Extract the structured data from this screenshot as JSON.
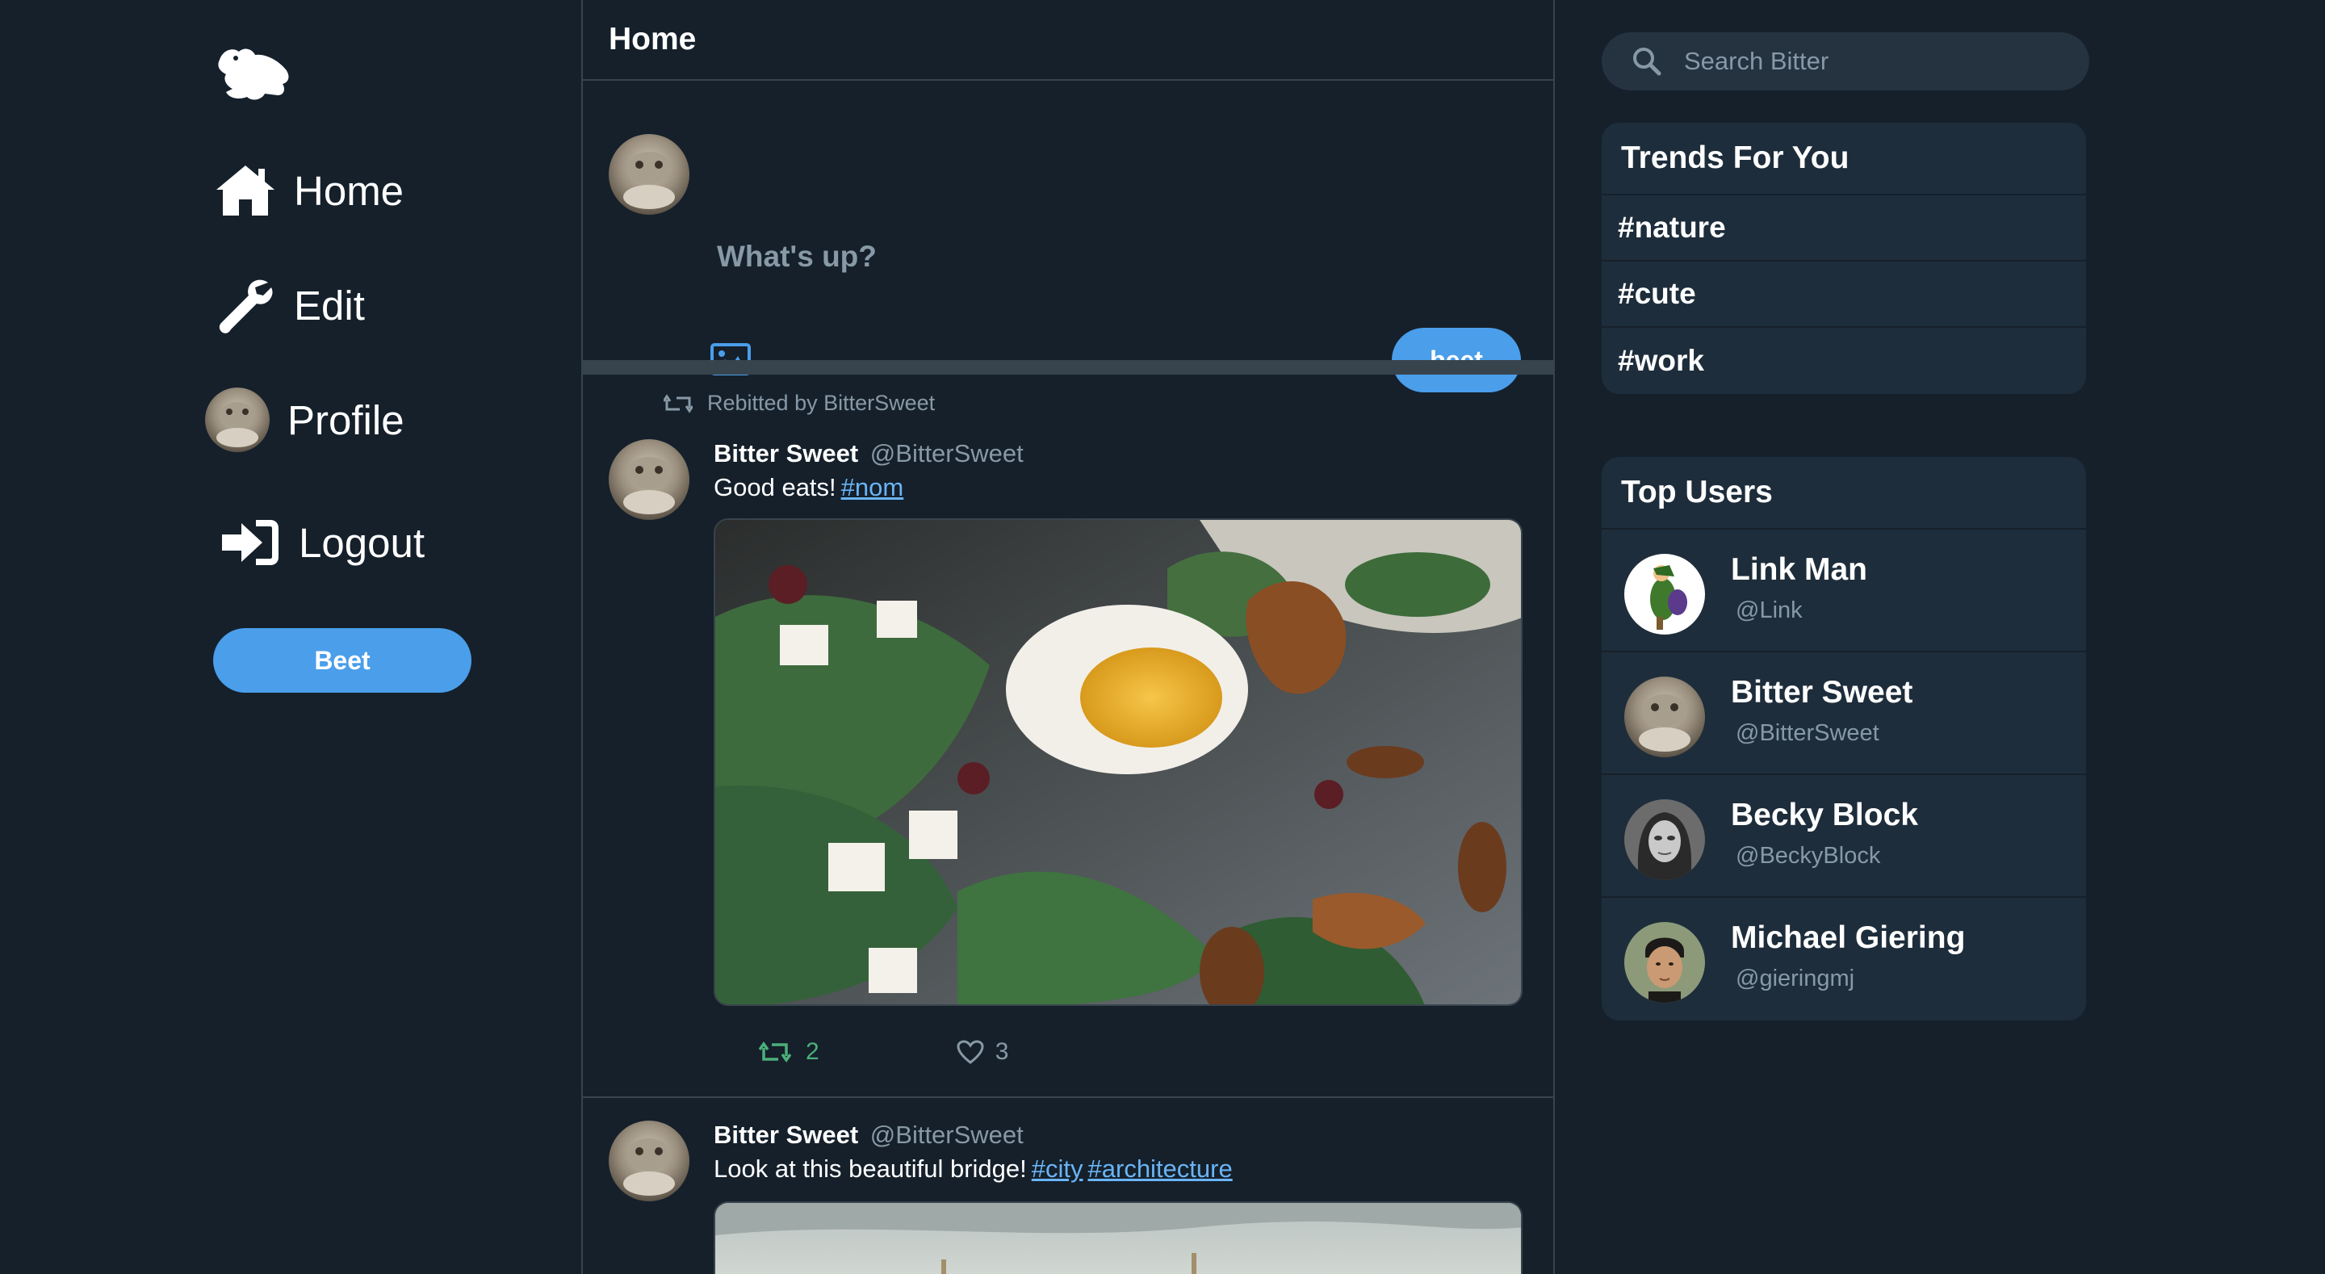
{
  "nav": {
    "items": [
      {
        "label": "Home",
        "icon": "home-icon"
      },
      {
        "label": "Edit",
        "icon": "wrench-icon"
      },
      {
        "label": "Profile",
        "icon": "avatar"
      },
      {
        "label": "Logout",
        "icon": "logout-icon"
      }
    ],
    "beet_label": "Beet",
    "logo": "frog-logo-icon"
  },
  "feed": {
    "title": "Home",
    "composer": {
      "placeholder": "What's up?",
      "submit_label": "beet"
    },
    "posts": [
      {
        "rebit_text": "Rebitted by BitterSweet",
        "name": "Bitter Sweet",
        "handle": "@BitterSweet",
        "text": "Good eats!",
        "tags": [
          "#nom"
        ],
        "rebeets": "2",
        "likes": "3"
      },
      {
        "name": "Bitter Sweet",
        "handle": "@BitterSweet",
        "text": "Look at this beautiful bridge!",
        "tags": [
          "#city",
          "#architecture"
        ]
      }
    ]
  },
  "search": {
    "placeholder": "Search Bitter"
  },
  "trends": {
    "title": "Trends For You",
    "items": [
      "#nature",
      "#cute",
      "#work"
    ]
  },
  "top_users": {
    "title": "Top Users",
    "users": [
      {
        "name": "Link Man",
        "handle": "@Link"
      },
      {
        "name": "Bitter Sweet",
        "handle": "@BitterSweet"
      },
      {
        "name": "Becky Block",
        "handle": "@BeckyBlock"
      },
      {
        "name": "Michael Giering",
        "handle": "@gieringmj"
      }
    ]
  },
  "colors": {
    "background": "#15202b",
    "panel": "#1e2d3b",
    "accent": "#4a9eea",
    "border": "#38444d",
    "muted": "#8899a6",
    "rebeet_green": "#4caf7a",
    "link": "#6ab4f5"
  }
}
